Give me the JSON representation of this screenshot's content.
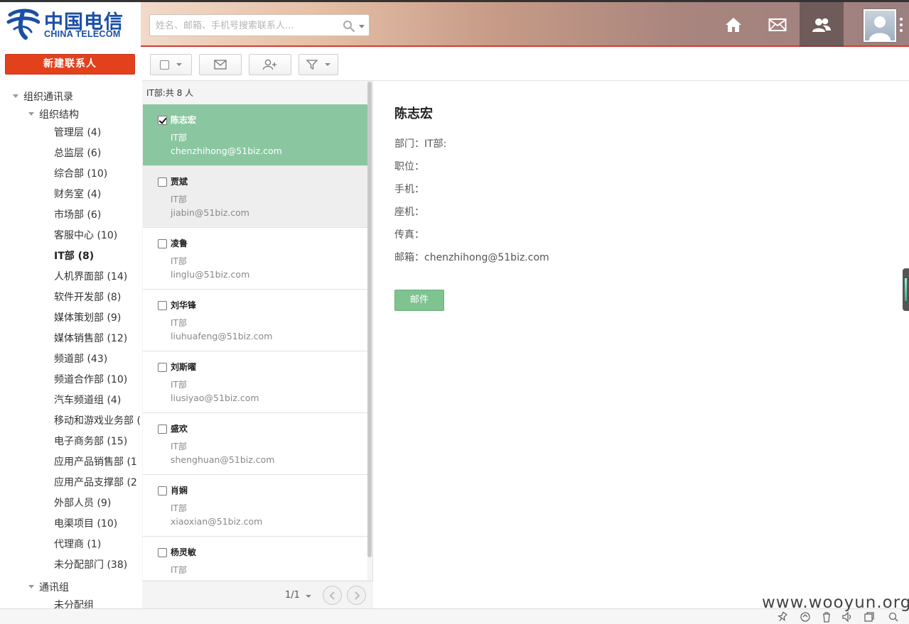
{
  "header": {
    "logo_cn": "中国电信",
    "logo_en": "CHINA TELECOM",
    "search_placeholder": "姓名、邮箱、手机号搜索联系人...",
    "nav": [
      {
        "name": "home",
        "icon": "home-icon"
      },
      {
        "name": "mail",
        "icon": "mail-icon"
      },
      {
        "name": "contacts",
        "icon": "contacts-icon",
        "active": true
      }
    ]
  },
  "sidebar": {
    "new_contact": "新建联系人",
    "tree": {
      "root": "组织通讯录",
      "org_structure": "组织结构",
      "departments": [
        "管理层 (4)",
        "总监层 (6)",
        "综合部 (10)",
        "财务室 (4)",
        "市场部 (6)",
        "客服中心 (10)",
        "IT部 (8)",
        "人机界面部 (14)",
        "软件开发部 (8)",
        "媒体策划部 (9)",
        "媒体销售部 (12)",
        "频道部 (43)",
        "频道合作部 (10)",
        "汽车频道组 (4)",
        "移动和游戏业务部 (",
        "电子商务部 (15)",
        "应用产品销售部 (1",
        "应用产品支撑部 (2",
        "外部人员 (9)",
        "电渠项目 (10)",
        "代理商 (1)",
        "未分配部门 (38)"
      ],
      "selected_index": 6,
      "groups": "通讯组",
      "unassigned_group": "未分配组"
    }
  },
  "toolbar": {
    "icons": [
      "checkbox-dropdown",
      "envelope-icon",
      "add-user-icon",
      "filter-icon"
    ]
  },
  "list": {
    "heading": "IT部:共 8 人",
    "contacts": [
      {
        "name": "陈志宏",
        "dept": "IT部",
        "email": "chenzhihong@51biz.com",
        "checked": true,
        "selected": true
      },
      {
        "name": "贾斌",
        "dept": "IT部",
        "email": "jiabin@51biz.com",
        "checked": false
      },
      {
        "name": "凌鲁",
        "dept": "IT部",
        "email": "linglu@51biz.com",
        "checked": false
      },
      {
        "name": "刘华锋",
        "dept": "IT部",
        "email": "liuhuafeng@51biz.com",
        "checked": false
      },
      {
        "name": "刘斯曜",
        "dept": "IT部",
        "email": "liusiyao@51biz.com",
        "checked": false
      },
      {
        "name": "盛欢",
        "dept": "IT部",
        "email": "shenghuan@51biz.com",
        "checked": false
      },
      {
        "name": "肖娴",
        "dept": "IT部",
        "email": "xiaoxian@51biz.com",
        "checked": false
      },
      {
        "name": "杨灵敏",
        "dept": "IT部",
        "email": "",
        "checked": false
      }
    ],
    "pager": "1/1"
  },
  "detail": {
    "name": "陈志宏",
    "dept": "部门：IT部:",
    "title": "职位：",
    "mobile": "手机：",
    "phone": "座机：",
    "fax": "传真：",
    "email": "邮箱：chenzhihong@51biz.com",
    "mail_button": "邮件"
  },
  "watermark": "www.wooyun.org",
  "colors": {
    "brand_red": "#e2411c",
    "selected_green": "#8ac7a0",
    "button_green": "#7fc391",
    "logo_blue": "#1a4fa6"
  }
}
